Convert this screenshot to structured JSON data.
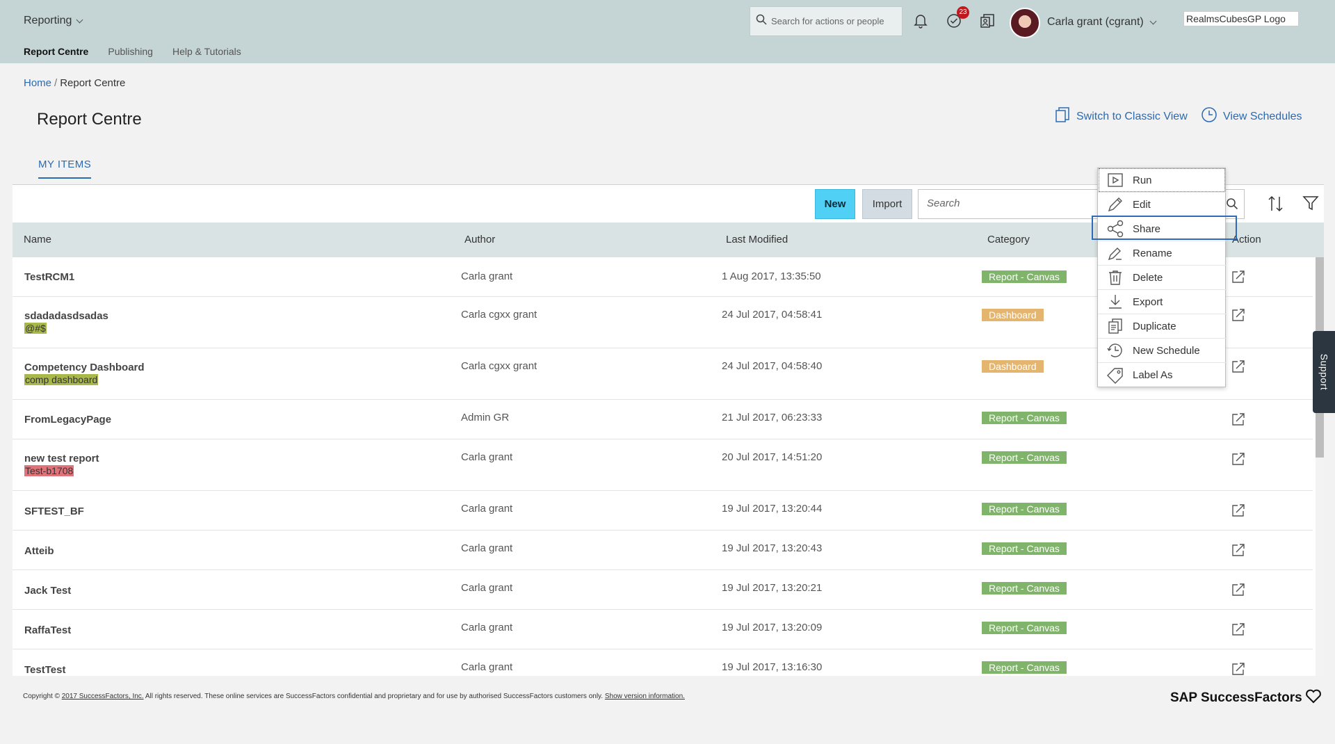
{
  "header": {
    "app_name": "Reporting",
    "subnav": [
      "Report Centre",
      "Publishing",
      "Help & Tutorials"
    ],
    "search_placeholder": "Search for actions or people",
    "notifications_badge": "23",
    "user_name": "Carla grant (cgrant)",
    "logo_alt": "RealmsCubesGP Logo"
  },
  "breadcrumb": {
    "home": "Home",
    "separator": "/",
    "current": "Report Centre"
  },
  "page": {
    "title": "Report Centre",
    "switch_classic": "Switch to Classic View",
    "view_schedules": "View Schedules",
    "tab": "MY ITEMS"
  },
  "toolbar": {
    "new_label": "New",
    "import_label": "Import",
    "search_placeholder": "Search"
  },
  "table": {
    "columns": [
      "Name",
      "Author",
      "Last Modified",
      "Category",
      "Action"
    ],
    "rows": [
      {
        "name": "TestRCM1",
        "label": "",
        "author": "Carla grant",
        "modified": "1 Aug 2017, 13:35:50",
        "category": "Report - Canvas"
      },
      {
        "name": "sdadadasdsadas",
        "label": "@#$",
        "author": "Carla cgxx grant",
        "modified": "24 Jul 2017, 04:58:41",
        "category": "Dashboard"
      },
      {
        "name": "Competency Dashboard",
        "label": "comp dashboard",
        "author": "Carla cgxx grant",
        "modified": "24 Jul 2017, 04:58:40",
        "category": "Dashboard"
      },
      {
        "name": "FromLegacyPage",
        "label": "",
        "author": "Admin GR",
        "modified": "21 Jul 2017, 06:23:33",
        "category": "Report - Canvas"
      },
      {
        "name": "new test report",
        "label": "Test-b1708",
        "author": "Carla grant",
        "modified": "20 Jul 2017, 14:51:20",
        "category": "Report - Canvas"
      },
      {
        "name": "SFTEST_BF",
        "label": "",
        "author": "Carla grant",
        "modified": "19 Jul 2017, 13:20:44",
        "category": "Report - Canvas"
      },
      {
        "name": "Atteib",
        "label": "",
        "author": "Carla grant",
        "modified": "19 Jul 2017, 13:20:43",
        "category": "Report - Canvas"
      },
      {
        "name": "Jack Test",
        "label": "",
        "author": "Carla grant",
        "modified": "19 Jul 2017, 13:20:21",
        "category": "Report - Canvas"
      },
      {
        "name": "RaffaTest",
        "label": "",
        "author": "Carla grant",
        "modified": "19 Jul 2017, 13:20:09",
        "category": "Report - Canvas"
      },
      {
        "name": "TestTest",
        "label": "",
        "author": "Carla grant",
        "modified": "19 Jul 2017, 13:16:30",
        "category": "Report - Canvas"
      }
    ]
  },
  "context_menu": {
    "items": [
      "Run",
      "Edit",
      "Share",
      "Rename",
      "Delete",
      "Export",
      "Duplicate",
      "New Schedule",
      "Label As"
    ],
    "highlighted": "Share"
  },
  "support_label": "Support",
  "footer": {
    "copyright_prefix": "Copyright ©",
    "company_link": "2017 SuccessFactors, Inc.",
    "rights_text": "All rights reserved. These online services are SuccessFactors confidential and proprietary and for use by authorised SuccessFactors customers only.",
    "version_link": "Show version information.",
    "brand": "SAP SuccessFactors"
  },
  "colors": {
    "header_bg": "#c5d4d4",
    "accent_blue": "#2a6ab2",
    "new_button": "#4fd0f4",
    "category_green": "#7fb46a",
    "category_orange": "#e4b56f",
    "label_olive": "#a8b84a",
    "label_red": "#e0737a"
  }
}
